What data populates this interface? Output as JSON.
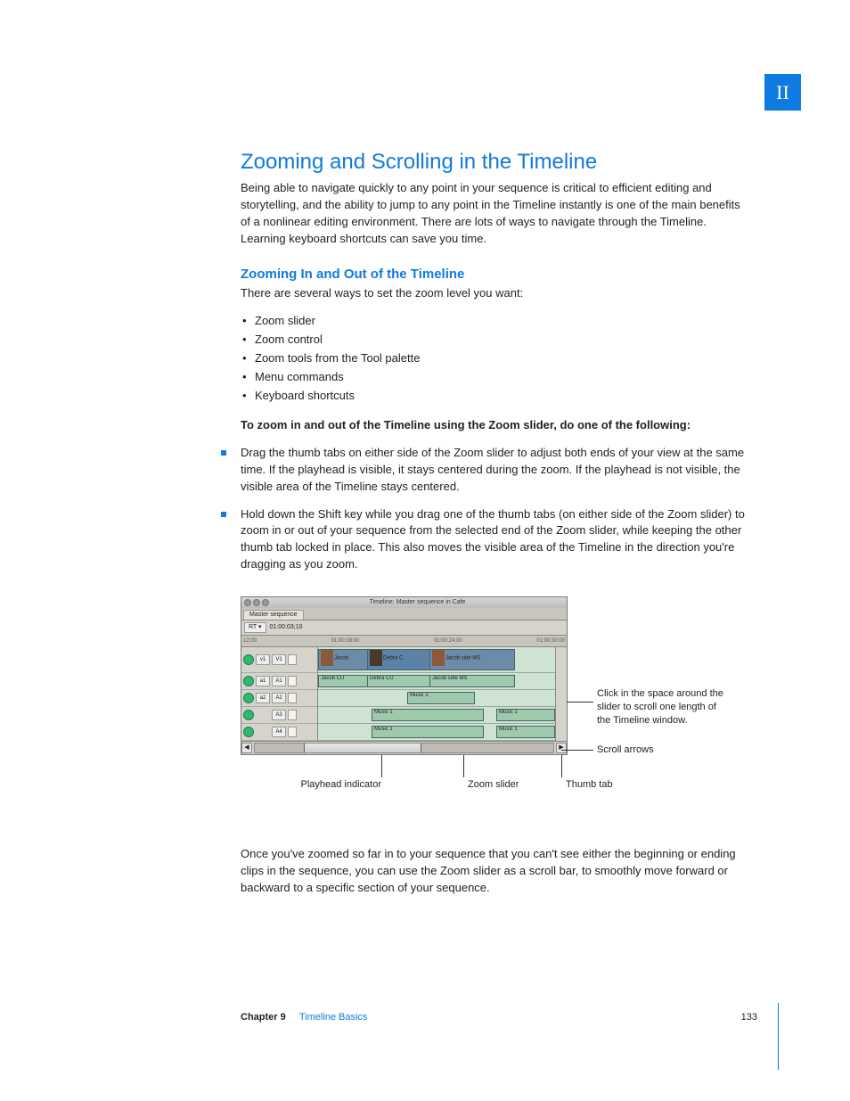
{
  "section_tab": "II",
  "heading_main": "Zooming and Scrolling in the Timeline",
  "intro": "Being able to navigate quickly to any point in your sequence is critical to efficient editing and storytelling, and the ability to jump to any point in the Timeline instantly is one of the main benefits of a nonlinear editing environment. There are lots of ways to navigate through the Timeline. Learning keyboard shortcuts can save you time.",
  "heading_sub": "Zooming In and Out of the Timeline",
  "sub_intro": "There are several ways to set the zoom level you want:",
  "bullets": {
    "b0": "Zoom slider",
    "b1": "Zoom control",
    "b2": "Zoom tools from the Tool palette",
    "b3": "Menu commands",
    "b4": "Keyboard shortcuts"
  },
  "instruction_bold": "To zoom in and out of the Timeline using the Zoom slider, do one of the following:",
  "steps": {
    "s0": "Drag the thumb tabs on either side of the Zoom slider to adjust both ends of your view at the same time. If the playhead is visible, it stays centered during the zoom. If the playhead is not visible, the visible area of the Timeline stays centered.",
    "s1": "Hold down the Shift key while you drag one of the thumb tabs (on either side of the Zoom slider) to zoom in or out of your sequence from the selected end of the Zoom slider, while keeping the other thumb tab locked in place. This also moves the visible area of the Timeline in the direction you're dragging as you zoom."
  },
  "figure": {
    "window_title": "Timeline: Master sequence in Cafe",
    "tab": "Master sequence",
    "rt": "RT ▾",
    "timecode": "01:00:03;10",
    "ruler": {
      "r0": "12:00",
      "r1": "01:00:18:00",
      "r2": "01:00:24:00",
      "r3": "01:00:30:00"
    },
    "tracks": {
      "v1_src": "v1",
      "v1_dst": "V1",
      "a1_src": "a1",
      "a1_dst": "A1",
      "a2_src": "a2",
      "a2_dst": "A2",
      "a3_dst": "A3",
      "a4_dst": "A4"
    },
    "clips": {
      "v_jacob": "Jacob",
      "v_debra": "Debra C",
      "v_jacob_side": "Jacob side MS",
      "a_jacob_cu": "Jacob CU",
      "a_debra_cu": "Debra CU",
      "a_jacob_side_ms": "Jacob side MS",
      "music1": "Music 1",
      "music2": "Music 2"
    },
    "callouts": {
      "space": "Click in the space around the slider to scroll one length of the Timeline window.",
      "arrows": "Scroll arrows",
      "playhead": "Playhead indicator",
      "zoom": "Zoom slider",
      "thumb": "Thumb tab"
    }
  },
  "outro": "Once you've zoomed so far in to your sequence that you can't see either the beginning or ending clips in the sequence, you can use the Zoom slider as a scroll bar, to smoothly move forward or backward to a specific section of your sequence.",
  "footer": {
    "chapter": "Chapter 9",
    "title": "Timeline Basics",
    "page": "133"
  }
}
